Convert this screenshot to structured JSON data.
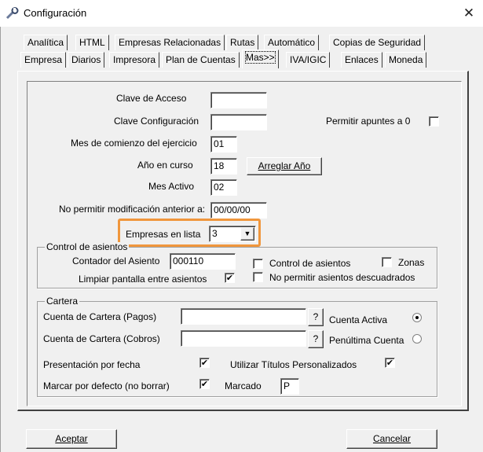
{
  "window": {
    "title": "Configuración",
    "close_glyph": "✕"
  },
  "tabs_row1": [
    "Analítica",
    "HTML",
    "Empresas Relacionadas",
    "Rutas",
    "Automático",
    "Copias de Seguridad"
  ],
  "tabs_row2": [
    "Empresa",
    "Diarios",
    "Impresora",
    "Plan de Cuentas",
    "Mas>>",
    "IVA/IGIC",
    "Enlaces",
    "Moneda"
  ],
  "active_tab": "Mas>>",
  "form": {
    "clave_acceso": {
      "label": "Clave de Acceso",
      "value": ""
    },
    "clave_config": {
      "label": "Clave Configuración",
      "value": ""
    },
    "permitir_cero": {
      "label": "Permitir apuntes a 0",
      "checked": false
    },
    "mes_comienzo": {
      "label": "Mes de comienzo del ejercicio",
      "value": "01"
    },
    "anio_curso": {
      "label": "Año en curso",
      "value": "18"
    },
    "arreglar_btn": "Arreglar Año",
    "mes_activo": {
      "label": "Mes Activo",
      "value": "02"
    },
    "no_modificacion": {
      "label": "No permitir modificación anterior a:",
      "value": "00/00/00"
    },
    "empresas_lista": {
      "label": "Empresas en lista",
      "value": "3"
    }
  },
  "control": {
    "title": "Control de asientos",
    "contador_label": "Contador del Asiento",
    "contador_value": "000110",
    "control_label": "Control de asientos",
    "control_checked": false,
    "zonas_label": "Zonas",
    "zonas_checked": false,
    "limpiar_label": "Limpiar pantalla entre asientos",
    "limpiar_checked": true,
    "descuadrados_label": "No permitir asientos descuadrados",
    "descuadrados_checked": false
  },
  "cartera": {
    "title": "Cartera",
    "pagos_label": "Cuenta de Cartera (Pagos)",
    "pagos_value": "",
    "cobros_label": "Cuenta de Cartera (Cobros)",
    "cobros_value": "",
    "lookup": "?",
    "activa_label": "Cuenta Activa",
    "activa_selected": true,
    "penultima_label": "Penúltima Cuenta",
    "penultima_selected": false,
    "fecha_label": "Presentación por fecha",
    "fecha_checked": true,
    "titulos_label": "Utilizar Títulos Personalizados",
    "titulos_checked": true,
    "marcar_label": "Marcar por defecto (no borrar)",
    "marcar_checked": true,
    "marcado_label": "Marcado",
    "marcado_value": "P"
  },
  "footer": {
    "ok": "Aceptar",
    "cancel": "Cancelar"
  },
  "colors": {
    "highlight": "#f0963c",
    "face": "#f0f0f0"
  },
  "icons": {
    "app": "wrench-icon",
    "dropdown": "chevron-down-icon",
    "check": "checkmark-icon"
  }
}
